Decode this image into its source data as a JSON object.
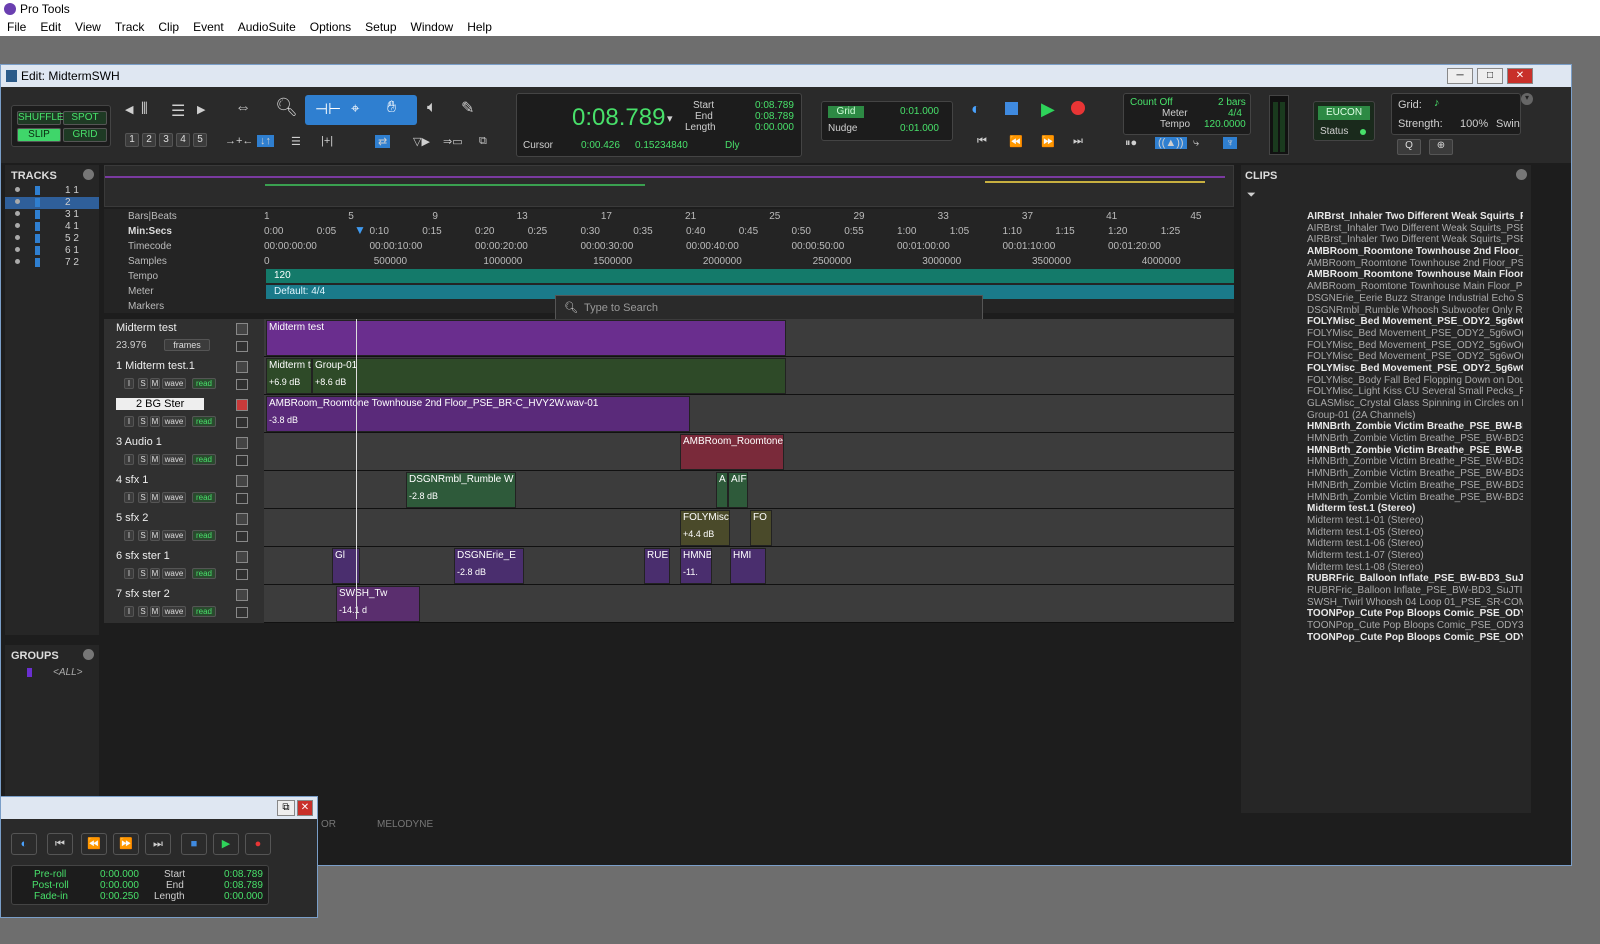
{
  "app": {
    "title": "Pro Tools"
  },
  "menu": [
    "File",
    "Edit",
    "View",
    "Track",
    "Clip",
    "Event",
    "AudioSuite",
    "Options",
    "Setup",
    "Window",
    "Help"
  ],
  "edit_window": {
    "title": "Edit: MidtermSWH"
  },
  "modes": {
    "shuffle": "SHUFFLE",
    "spot": "SPOT",
    "slip": "SLIP",
    "grid": "GRID"
  },
  "zoom_presets": [
    "1",
    "2",
    "3",
    "4",
    "5"
  ],
  "counter": {
    "main": "0:08.789",
    "start_label": "Start",
    "end_label": "End",
    "length_label": "Length",
    "start": "0:08.789",
    "end": "0:08.789",
    "length": "0:00.000",
    "cursor_label": "Cursor",
    "cursor": "0:00.426",
    "cursor2": "0.15234840",
    "dly": "Dly"
  },
  "grid": {
    "label": "Grid",
    "value": "0:01.000",
    "nudge_label": "Nudge",
    "nudge": "0:01.000"
  },
  "midi": {
    "count": "Count Off",
    "bars": "2 bars",
    "meter_label": "Meter",
    "meter": "4/4",
    "tempo_label": "Tempo",
    "tempo": "120.0000"
  },
  "eucon": {
    "label": "EUCON",
    "status": "Status"
  },
  "grid_panel": {
    "grid": "Grid:",
    "strength": "Strength:",
    "strength_val": "100%",
    "swing": "Swin"
  },
  "tracks_panel": {
    "title": "TRACKS",
    "items": [
      {
        "n": "1 1"
      },
      {
        "n": "2"
      },
      {
        "n": "3 1"
      },
      {
        "n": "4 1"
      },
      {
        "n": "5 2"
      },
      {
        "n": "6 1"
      },
      {
        "n": "7 2"
      }
    ]
  },
  "groups_panel": {
    "title": "GROUPS",
    "all": "<ALL>"
  },
  "rulers": {
    "bars": "Bars|Beats",
    "min": "Min:Secs",
    "timecode": "Timecode",
    "samples": "Samples",
    "tempo": "Tempo",
    "meter": "Meter",
    "markers": "Markers",
    "bar_ticks": [
      "1",
      "5",
      "9",
      "13",
      "17",
      "21",
      "25",
      "29",
      "33",
      "37",
      "41",
      "45"
    ],
    "min_ticks": [
      "0:00",
      "0:05",
      "0:10",
      "0:15",
      "0:20",
      "0:25",
      "0:30",
      "0:35",
      "0:40",
      "0:45",
      "0:50",
      "0:55",
      "1:00",
      "1:05",
      "1:10",
      "1:15",
      "1:20",
      "1:25"
    ],
    "tc_ticks": [
      "00:00:00:00",
      "00:00:10:00",
      "00:00:20:00",
      "00:00:30:00",
      "00:00:40:00",
      "00:00:50:00",
      "00:01:00:00",
      "00:01:10:00",
      "00:01:20:00"
    ],
    "sample_ticks": [
      "0",
      "500000",
      "1000000",
      "1500000",
      "2000000",
      "2500000",
      "3000000",
      "3500000",
      "4000000"
    ],
    "tempo_val": "120",
    "meter_val": "Default: 4/4"
  },
  "search": {
    "placeholder": "Type to Search"
  },
  "tracks": [
    {
      "name": "Midterm test",
      "fps": "23.976",
      "frames": "frames"
    },
    {
      "name": "1 Midterm test.1"
    },
    {
      "name": "2   BG Ster"
    },
    {
      "name": "3 Audio 1"
    },
    {
      "name": "4      sfx 1"
    },
    {
      "name": "5      sfx 2"
    },
    {
      "name": "6    sfx ster 1"
    },
    {
      "name": "7    sfx ster 2"
    }
  ],
  "track_btns": {
    "i": "I",
    "s": "S",
    "m": "M",
    "wave": "wave",
    "read": "read"
  },
  "clips": {
    "video": "Midterm test",
    "c1a": "Midterm t",
    "c1b": "Group-01",
    "c1g1": "+6.9 dB",
    "c1g2": "+8.6 dB",
    "c2": "AMBRoom_Roomtone Townhouse 2nd Floor_PSE_BR-C_HVY2W.wav-01",
    "c2g": "-3.8 dB",
    "c3": "AMBRoom_Roomtone",
    "c4a": "DSGNRmbl_Rumble W",
    "c4ag": "-2.8 dB",
    "c4b": "A",
    "c4c": "AIF",
    "c5a": "FOLYMisc",
    "c5ag": "+4.4 dB",
    "c5b": "FO",
    "c6a": "Gl",
    "c6b": "DSGNErie_E",
    "c6bg": "-2.8 dB",
    "c6c": "RUE",
    "c6d": "HMNB",
    "c6dg": "-11.",
    "c6e": "HMI",
    "c7a": "SWSH_Tw",
    "c7ag": "-14.1 d"
  },
  "clips_panel": {
    "title": "CLIPS",
    "items": [
      {
        "t": "AIRBrst_Inhaler Two Different Weak Squirts_PSE",
        "b": true
      },
      {
        "t": "AIRBrst_Inhaler Two Different Weak Squirts_PSE_",
        "b": false
      },
      {
        "t": "AIRBrst_Inhaler Two Different Weak Squirts_PSE_",
        "b": false
      },
      {
        "t": "AMBRoom_Roomtone Townhouse 2nd Floor_PS",
        "b": true
      },
      {
        "t": "AMBRoom_Roomtone Townhouse 2nd Floor_PSE",
        "b": false
      },
      {
        "t": "AMBRoom_Roomtone Townhouse Main Floor_PS",
        "b": true
      },
      {
        "t": "AMBRoom_Roomtone Townhouse Main Floor_PSE",
        "b": false
      },
      {
        "t": "DSGNErie_Eerie Buzz Strange Industrial Echo Sc",
        "b": false
      },
      {
        "t": "DSGNRmbl_Rumble Whoosh Subwoofer Only Run",
        "b": false
      },
      {
        "t": "FOLYMisc_Bed Movement_PSE_ODY2_5g6wO(",
        "b": true
      },
      {
        "t": "FOLYMisc_Bed Movement_PSE_ODY2_5g6wO(2)",
        "b": false
      },
      {
        "t": "FOLYMisc_Bed Movement_PSE_ODY2_5g6wO(2)",
        "b": false
      },
      {
        "t": "FOLYMisc_Bed Movement_PSE_ODY2_5g6wO(2)",
        "b": false
      },
      {
        "t": "FOLYMisc_Bed Movement_PSE_ODY2_5g6wO.",
        "b": true
      },
      {
        "t": "FOLYMisc_Body Fall Bed Flopping Down on Doub",
        "b": false
      },
      {
        "t": "FOLYMisc_Light Kiss CU Several Small Pecks_PS",
        "b": false
      },
      {
        "t": "GLASMisc_Crystal Glass Spinning in Circles on Ma",
        "b": false
      },
      {
        "t": "Group-01 (2A Channels)",
        "b": false
      },
      {
        "t": "HMNBrth_Zombie Victim Breathe_PSE_BW-BD3_",
        "b": true
      },
      {
        "t": "HMNBrth_Zombie Victim Breathe_PSE_BW-BD3_",
        "b": false
      },
      {
        "t": "HMNBrth_Zombie Victim Breathe_PSE_BW-BD3_",
        "b": true
      },
      {
        "t": "HMNBrth_Zombie Victim Breathe_PSE_BW-BD3_",
        "b": false
      },
      {
        "t": "HMNBrth_Zombie Victim Breathe_PSE_BW-BD3_",
        "b": false
      },
      {
        "t": "HMNBrth_Zombie Victim Breathe_PSE_BW-BD3_",
        "b": false
      },
      {
        "t": "HMNBrth_Zombie Victim Breathe_PSE_BW-BD3_",
        "b": false
      },
      {
        "t": "Midterm test.1 (Stereo)",
        "b": true
      },
      {
        "t": "Midterm test.1-01 (Stereo)",
        "b": false
      },
      {
        "t": "Midterm test.1-05 (Stereo)",
        "b": false
      },
      {
        "t": "Midterm test.1-06 (Stereo)",
        "b": false
      },
      {
        "t": "Midterm test.1-07 (Stereo)",
        "b": false
      },
      {
        "t": "Midterm test.1-08 (Stereo)",
        "b": false
      },
      {
        "t": "RUBRFric_Balloon Inflate_PSE_BW-BD3_SuJTI.w",
        "b": true
      },
      {
        "t": "RUBRFric_Balloon Inflate_PSE_BW-BD3_SuJTI.w",
        "b": false
      },
      {
        "t": "SWSH_Twirl Whoosh 04 Loop 01_PSE_SR-COM_",
        "b": false
      },
      {
        "t": "TOONPop_Cute Pop Bloops Comic_PSE_ODY3_",
        "b": true
      },
      {
        "t": "TOONPop_Cute Pop Bloops Comic_PSE_ODY3_",
        "b": false
      },
      {
        "t": "TOONPop_Cute Pop Bloops Comic_PSE_ODY3_",
        "b": true
      }
    ]
  },
  "bottom_tabs": [
    "OR",
    "MELODYNE"
  ],
  "transport": {
    "preroll": "Pre-roll",
    "postroll": "Post-roll",
    "fadein": "Fade-in",
    "pre": "0:00.000",
    "post": "0:00.000",
    "fade": "0:00.250",
    "start_l": "Start",
    "end_l": "End",
    "len_l": "Length",
    "start": "0:08.789",
    "end": "0:08.789",
    "length": "0:00.000"
  },
  "colors": {
    "accent_blue": "#2f7fd0",
    "green": "#48e06a",
    "purple": "#6a2e8e",
    "meter_teal": "#1a8c8c"
  }
}
